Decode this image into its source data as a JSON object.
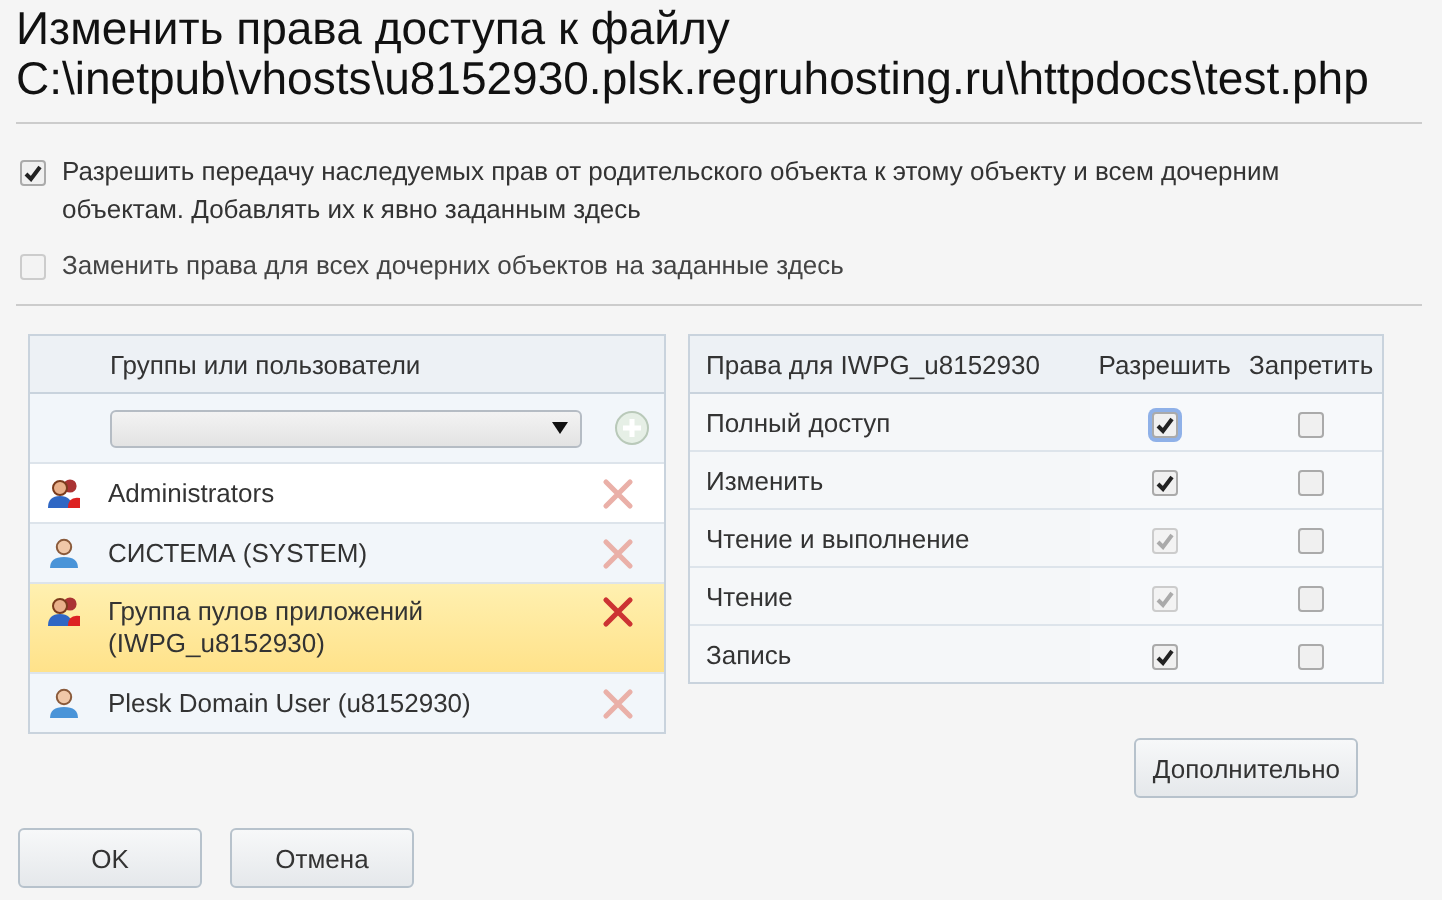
{
  "title": "Изменить права доступа к файлу",
  "path": "C:\\inetpub\\vhosts\\u8152930.plsk.regruhosting.ru\\httpdocs\\test.php",
  "options": [
    {
      "label": "Разрешить передачу наследуемых прав от родительского объекта к этому объекту и всем дочерним объектам. Добавлять их к явно заданным здесь",
      "checked": true,
      "disabled": false
    },
    {
      "label": "Заменить права для всех дочерних объектов на заданные здесь",
      "checked": false,
      "disabled": true
    }
  ],
  "users": {
    "header": "Группы или пользователи",
    "rows": [
      {
        "kind": "group",
        "name": "Administrators",
        "selected": false
      },
      {
        "kind": "user",
        "name": "СИСТЕМА (SYSTEM)",
        "selected": false
      },
      {
        "kind": "group",
        "name": "Группа пулов приложений (IWPG_u8152930)",
        "selected": true
      },
      {
        "kind": "user",
        "name": "Plesk Domain User (u8152930)",
        "selected": false
      }
    ]
  },
  "permissions": {
    "columns": [
      "Права для IWPG_u8152930",
      "Разрешить",
      "Запретить"
    ],
    "rows": [
      {
        "name": "Полный доступ",
        "allow": {
          "checked": true,
          "disabled": false,
          "focused": true
        },
        "deny": {
          "checked": false,
          "disabled": false,
          "focused": false
        }
      },
      {
        "name": "Изменить",
        "allow": {
          "checked": true,
          "disabled": false,
          "focused": false
        },
        "deny": {
          "checked": false,
          "disabled": false,
          "focused": false
        }
      },
      {
        "name": "Чтение и выполнение",
        "allow": {
          "checked": true,
          "disabled": true,
          "focused": false
        },
        "deny": {
          "checked": false,
          "disabled": false,
          "focused": false
        }
      },
      {
        "name": "Чтение",
        "allow": {
          "checked": true,
          "disabled": true,
          "focused": false
        },
        "deny": {
          "checked": false,
          "disabled": false,
          "focused": false
        }
      },
      {
        "name": "Запись",
        "allow": {
          "checked": true,
          "disabled": false,
          "focused": false
        },
        "deny": {
          "checked": false,
          "disabled": false,
          "focused": false
        }
      }
    ]
  },
  "advanced_button": "Дополнительно",
  "buttons": [
    "OK",
    "Отмена"
  ]
}
